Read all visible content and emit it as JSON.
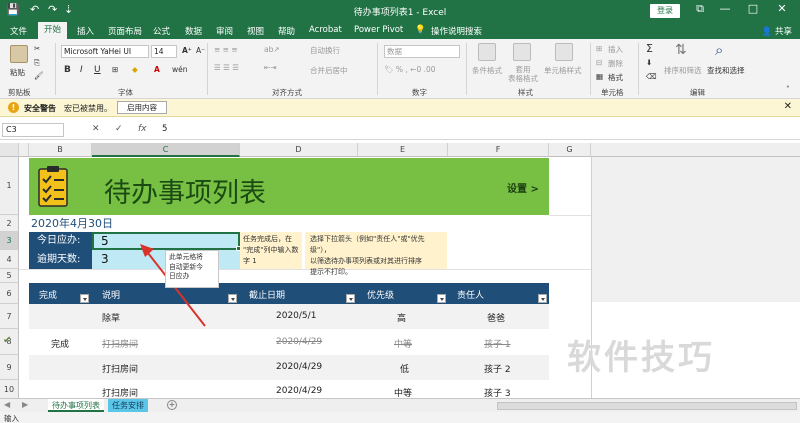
{
  "titlebar": {
    "title": "待办事项列表1 - Excel",
    "login_label": "登录",
    "qa_save": "💾",
    "qa_undo": "↶",
    "qa_redo": "↷",
    "qa_more": "⇣",
    "win_ribbon": "⧉",
    "win_min": "—",
    "win_max": "□",
    "win_close": "✕"
  },
  "menu": {
    "tabs": [
      "文件",
      "开始",
      "插入",
      "页面布局",
      "公式",
      "数据",
      "审阅",
      "视图",
      "帮助",
      "Acrobat",
      "Power Pivot"
    ],
    "active_tab": "开始",
    "search_placeholder": "操作说明搜索",
    "share_label": "共享"
  },
  "ribbon": {
    "clipboard": {
      "paste": "粘贴",
      "group": "剪贴板"
    },
    "font": {
      "name": "Microsoft YaHei UI",
      "size": "14",
      "bold": "B",
      "italic": "I",
      "underline": "U",
      "group": "字体",
      "grow": "A⁺",
      "shrink": "A⁻",
      "color_a": "A",
      "wen": "wén"
    },
    "alignment": {
      "wrap": "自动换行",
      "merge": "合并后居中",
      "group": "对齐方式"
    },
    "number": {
      "format": "数据",
      "group": "数字"
    },
    "styles": {
      "conditional": "条件格式",
      "table": "套用\n表格格式",
      "cell_styles": "单元格样式",
      "group": "样式"
    },
    "cells": {
      "insert": "插入",
      "delete": "删除",
      "format": "格式",
      "group": "单元格"
    },
    "editing": {
      "sum": "Σ",
      "sort": "排序和筛选",
      "find": "查找和选择",
      "group": "编辑"
    }
  },
  "security": {
    "title": "安全警告",
    "message": "宏已被禁用。",
    "button": "启用内容"
  },
  "formula_bar": {
    "name_box": "C3",
    "cancel": "✕",
    "enter": "✓",
    "fx": "fx",
    "value": "5"
  },
  "grid": {
    "columns": [
      "B",
      "C",
      "D",
      "E",
      "F",
      "G"
    ],
    "rows": [
      "1",
      "2",
      "3",
      "4",
      "5",
      "6",
      "7",
      "8",
      "9",
      "10"
    ],
    "selected_col": "C",
    "selected_row": "3"
  },
  "sheet": {
    "banner_title": "待办事项列表",
    "settings": "设置 >",
    "date": "2020年4月30日",
    "due_today_label": "今日应办:",
    "due_today_value": "5",
    "overdue_label": "逾期天数:",
    "overdue_value": "3",
    "note1": "任务完成后，在\n\"完成\"列中输入数\n字 1",
    "note2": "选择下拉箭头（例如\"责任人\"或\"优先级\"），\n以筛选待办事项列表或对其进行排序\n提示不打印。",
    "callout": "此单元格将\n自动更新今\n日应办",
    "headers": [
      "完成",
      "说明",
      "截止日期",
      "优先级",
      "责任人"
    ],
    "rows": [
      {
        "done": "",
        "desc": "除草",
        "date": "2020/5/1",
        "priority": "高",
        "owner": "爸爸",
        "strike": false,
        "check": false
      },
      {
        "done": "完成",
        "desc": "打扫房间",
        "date": "2020/4/29",
        "priority": "中等",
        "owner": "孩子 1",
        "strike": true,
        "check": true
      },
      {
        "done": "",
        "desc": "打扫房间",
        "date": "2020/4/29",
        "priority": "低",
        "owner": "孩子 2",
        "strike": false,
        "check": false
      },
      {
        "done": "",
        "desc": "打扫房间",
        "date": "2020/4/29",
        "priority": "中等",
        "owner": "孩子 3",
        "strike": false,
        "check": false
      }
    ]
  },
  "sheet_tabs": {
    "tab1": "待办事项列表",
    "tab2": "任务安排",
    "add": "+"
  },
  "status": {
    "mode": "输入"
  },
  "watermark": "软件技巧",
  "colors": {
    "excel_green": "#217346",
    "banner_green": "#77c043",
    "header_navy": "#1f4e79",
    "cell_cyan": "#bfeaf5",
    "note_yellow": "#fff2cc",
    "security_bg": "#fcf6d4",
    "arrow_red": "#d9342b"
  }
}
